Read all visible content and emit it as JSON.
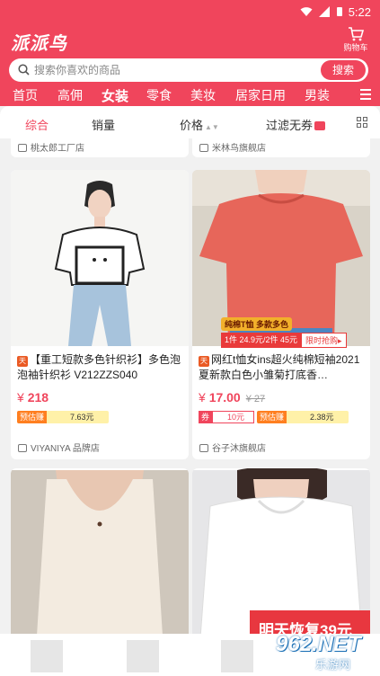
{
  "status_bar": {
    "time": "5:22"
  },
  "app": {
    "logo": "派派鸟",
    "cart_label": "购物车"
  },
  "search": {
    "placeholder": "搜索你喜欢的商品",
    "button": "搜索"
  },
  "categories": [
    {
      "label": "首页"
    },
    {
      "label": "高佣"
    },
    {
      "label": "女装",
      "active": true
    },
    {
      "label": "零食"
    },
    {
      "label": "美妆"
    },
    {
      "label": "居家日用"
    },
    {
      "label": "男装"
    }
  ],
  "sort_bar": {
    "items": [
      {
        "label": "综合",
        "active": true
      },
      {
        "label": "销量"
      },
      {
        "label": "价格"
      },
      {
        "label": "过滤无券"
      }
    ]
  },
  "products_top": [
    {
      "shop": "桃太郎工厂店"
    },
    {
      "shop": "米林鸟旗舰店"
    }
  ],
  "products": [
    {
      "title": "【重工短款多色针织衫】多色泡泡袖针织衫 V212ZZS040",
      "price_symbol": "¥",
      "price": "218",
      "earn_label": "预估赚",
      "earn_value": "7.63元",
      "shop": "VIYANIYA 品牌店"
    },
    {
      "title": "网红t恤女ins超火纯棉短袖2021夏新款白色小雏菊打底香…",
      "price_symbol": "¥",
      "price": "17.00",
      "old_price": "¥ 27",
      "coupon_label": "券",
      "coupon_value": "10元",
      "earn_label": "预估赚",
      "earn_value": "2.38元",
      "promo_line1": "纯棉T恤 多款多色",
      "promo_buy1": "1件 24.9元/2件 45元",
      "promo_cta": "限时抢购▸",
      "shop": "谷子沐旗舰店"
    },
    {
      "overlay_text": "明天恢复39元"
    }
  ],
  "watermark": {
    "brand": "962.NET",
    "sub": "乐游网"
  }
}
